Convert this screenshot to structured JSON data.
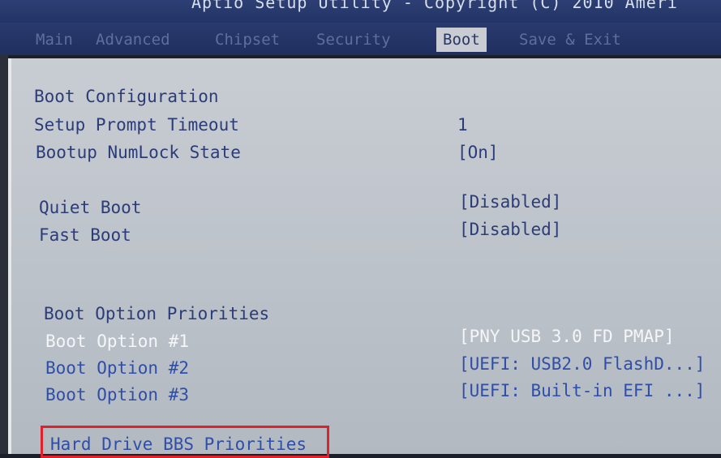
{
  "title": "Aptio Setup Utility - Copyright (C) 2010 Ameri",
  "tabs": [
    {
      "label": "Main"
    },
    {
      "label": "Advanced"
    },
    {
      "label": "Chipset"
    },
    {
      "label": "Security"
    },
    {
      "label": "Boot"
    },
    {
      "label": "Save & Exit"
    }
  ],
  "boot": {
    "section_header": "Boot Configuration",
    "setup_prompt_timeout": {
      "label": "Setup Prompt Timeout",
      "value": "1"
    },
    "bootup_numlock": {
      "label": "Bootup NumLock State",
      "value": "[On]"
    },
    "quiet_boot": {
      "label": "Quiet Boot",
      "value": "[Disabled]"
    },
    "fast_boot": {
      "label": "Fast Boot",
      "value": "[Disabled]"
    },
    "priorities_header": "Boot Option Priorities",
    "options": [
      {
        "label": "Boot Option #1",
        "value": "[PNY USB 3.0 FD PMAP]"
      },
      {
        "label": "Boot Option #2",
        "value": "[UEFI: USB2.0 FlashD...]"
      },
      {
        "label": "Boot Option #3",
        "value": "[UEFI: Built-in EFI ...]"
      }
    ],
    "hdd_bbs": {
      "label": "Hard Drive BBS Priorities"
    }
  },
  "colors": {
    "panel_bg": "#c4c9cf",
    "menu_blue": "#2c3c78",
    "selected_white": "#f4f6f8",
    "highlight_red": "#e0202a"
  }
}
